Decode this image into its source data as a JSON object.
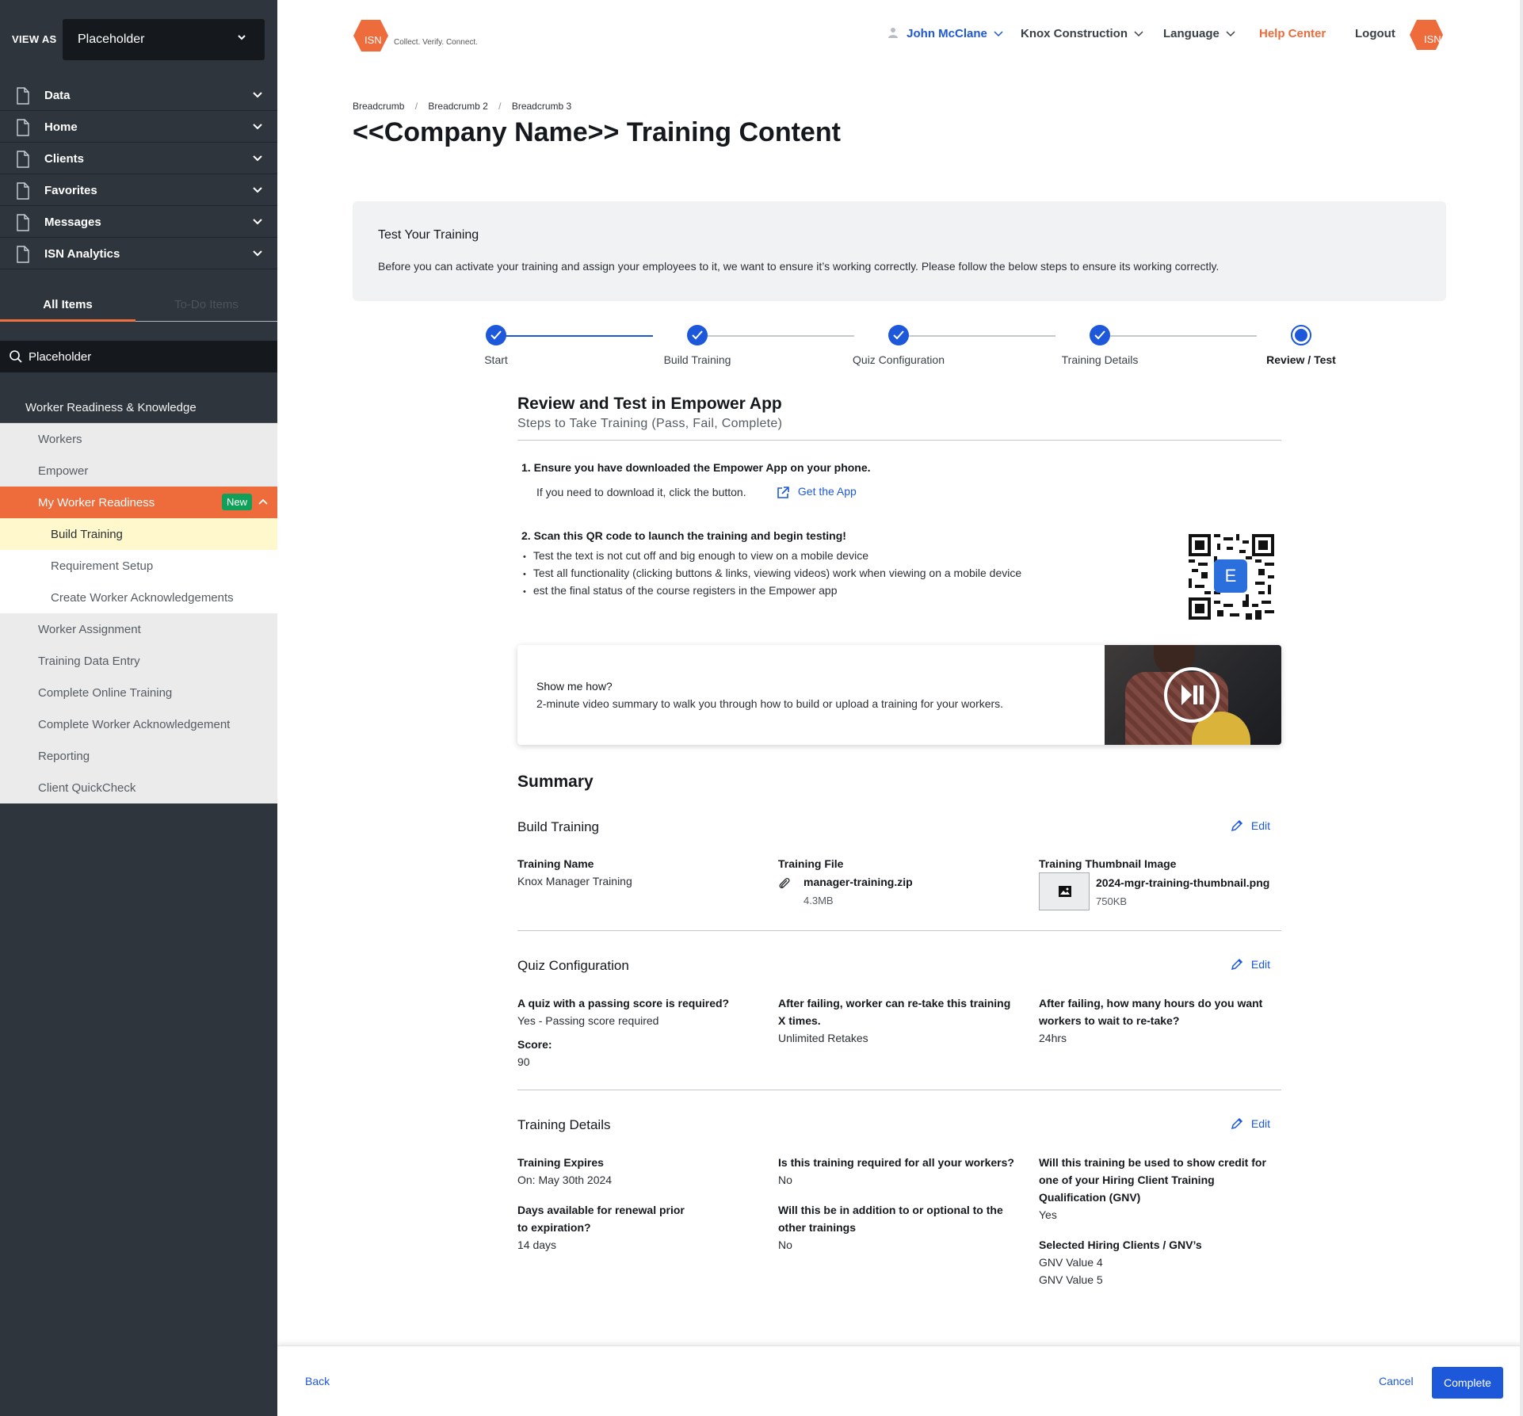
{
  "sidebar": {
    "view_as_label": "VIEW AS",
    "view_as_value": "Placeholder",
    "nav": [
      {
        "label": "Data"
      },
      {
        "label": "Home"
      },
      {
        "label": "Clients"
      },
      {
        "label": "Favorites"
      },
      {
        "label": "Messages"
      },
      {
        "label": "ISN Analytics"
      }
    ],
    "tabs": {
      "all": "All Items",
      "todo": "To-Do Items"
    },
    "search_value": "Placeholder",
    "tree": {
      "heading": "Worker Readiness & Knowledge",
      "items_before": [
        "Workers",
        "Empower"
      ],
      "active": {
        "label": "My Worker Readiness",
        "badge": "New"
      },
      "subitems": [
        "Build Training",
        "Requirement Setup",
        "Create Worker Acknowledgements"
      ],
      "items_after": [
        "Worker Assignment",
        "Training Data Entry",
        "Complete Online Training",
        "Complete Worker Acknowledgement",
        "Reporting",
        "Client QuickCheck"
      ]
    }
  },
  "header": {
    "logo_text": "ISN",
    "tagline": "Collect. Verify. Connect.",
    "user": "John McClane",
    "company": "Knox Construction",
    "language": "Language",
    "help": "Help Center",
    "logout": "Logout"
  },
  "breadcrumbs": [
    "Breadcrumb",
    "Breadcrumb 2",
    "Breadcrumb 3"
  ],
  "page_title": "<<Company Name>> Training Content",
  "info": {
    "title": "Test Your Training",
    "text": "Before you can activate your training and assign your employees to it, we want to ensure it’s working correctly. Please follow the below steps to ensure its working correctly."
  },
  "stepper": {
    "steps": [
      "Start",
      "Build Training",
      "Quiz Configuration",
      "Training Details",
      "Review / Test"
    ],
    "current_index": 4
  },
  "review": {
    "title": "Review and Test in Empower App",
    "subtitle": "Steps to Take Training (Pass, Fail, Complete)",
    "step1": "1. Ensure you have downloaded the Empower App on your phone.",
    "step1_note": "If you need to download it, click the button.",
    "get_app": "Get the App",
    "step2": "2. Scan this QR code to launch the training and begin testing!",
    "bullets": [
      "Test the text is not cut off and big enough to view on a mobile device",
      "Test all functionality (clicking buttons & links, viewing videos) work when viewing on a mobile device",
      "est the final status of the course registers in the Empower app"
    ],
    "qr_badge": "E"
  },
  "video": {
    "title": "Show me how?",
    "description": "2-minute video summary to walk you through how to build or upload a training for your workers."
  },
  "summary": {
    "title": "Summary",
    "edit_label": "Edit",
    "build": {
      "title": "Build Training",
      "name_label": "Training Name",
      "name_value": "Knox Manager Training",
      "file_label": "Training File",
      "file_name": "manager-training.zip",
      "file_size": "4.3MB",
      "thumb_label": "Training Thumbnail Image",
      "thumb_name": "2024-mgr-training-thumbnail.png",
      "thumb_size": "750KB"
    },
    "quiz": {
      "title": "Quiz Configuration",
      "q1_label": "A quiz with a passing score is required?",
      "q1_value": "Yes - Passing score required",
      "score_label": "Score:",
      "score_value": "90",
      "q2_label_1": "After failing, worker can re-take this training",
      "q2_label_2": "X times.",
      "q2_value": "Unlimited Retakes",
      "q3_label_1": "After failing, how many hours do you want",
      "q3_label_2": "workers to wait to re-take?",
      "q3_value": "24hrs"
    },
    "details": {
      "title": "Training Details",
      "expires_label": "Training Expires",
      "expires_value": "On: May 30th 2024",
      "renewal_label_1": "Days available for renewal prior",
      "renewal_label_2": "to expiration?",
      "renewal_value": "14 days",
      "required_label": "Is this training required for all your workers?",
      "required_value": "No",
      "addition_label_1": "Will this be in addition to or optional to the",
      "addition_label_2": "other trainings",
      "addition_value": "No",
      "credit_label_1": "Will this training be used to show credit for",
      "credit_label_2": "one of your Hiring Client Training",
      "credit_label_3": "Qualification (GNV)",
      "credit_value": "Yes",
      "clients_label": "Selected Hiring Clients / GNV’s",
      "clients_values": [
        "GNV Value 4",
        "GNV Value 5"
      ]
    }
  },
  "footer": {
    "back": "Back",
    "cancel": "Cancel",
    "complete": "Complete"
  },
  "colors": {
    "accent": "#1c58d9",
    "brand": "#ee6b3b",
    "sidebar": "#2e353d",
    "badge": "#11a05a"
  }
}
